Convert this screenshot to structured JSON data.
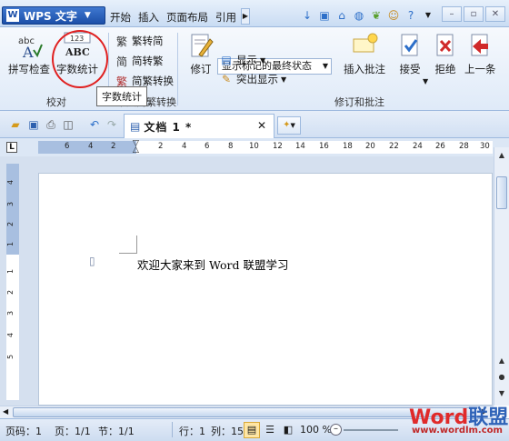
{
  "app": {
    "name": "WPS 文字",
    "logo": "W"
  },
  "menu_tabs": [
    "开始",
    "插入",
    "页面布局",
    "引用"
  ],
  "ribbon": {
    "proof_group": {
      "label": "校对",
      "spellcheck_label": "拼写检查",
      "wordcount_label": "字数统计",
      "wordcount_icon_text": {
        "top": "123",
        "bottom": "ABC"
      },
      "spell_icon_text": "abc"
    },
    "convert_group": {
      "trad_to_simp": "繁转简",
      "simp_to_trad": "简转繁",
      "convert": "简繁转换",
      "label": "中文简繁转换"
    },
    "track_group": {
      "label": "修订和批注",
      "revise_label": "修订",
      "status_select": "显示标记的最终状态",
      "show_label": "显示",
      "highlight_label": "突出显示",
      "insert_comment": "插入批注",
      "accept": "接受",
      "reject": "拒绝",
      "prev": "上一条"
    }
  },
  "tooltip": "字数统计",
  "document_tab": {
    "name": "文档 1 *"
  },
  "ruler": {
    "h_ticks": [
      "6",
      "4",
      "2",
      "2",
      "4",
      "6",
      "8",
      "10",
      "12",
      "14",
      "16",
      "18",
      "20",
      "22",
      "24",
      "26",
      "28",
      "30"
    ],
    "v_ticks": [
      "4",
      "3",
      "2",
      "1",
      "1",
      "2",
      "3",
      "4",
      "5"
    ]
  },
  "document": {
    "text": "欢迎大家来到 Word 联盟学习"
  },
  "statusbar": {
    "page_code": "页码：1",
    "page": "页：1/1",
    "section": "节：1/1",
    "row": "行：1",
    "col": "列：15",
    "zoom": "100 %"
  },
  "watermark": {
    "brand_a": "Word",
    "brand_b": "联盟",
    "url": "www.wordlm.com"
  },
  "colors": {
    "accent": "#1c4fa8",
    "highlight_circle": "#e02020",
    "ribbon_bg": "#dfeaf8"
  }
}
